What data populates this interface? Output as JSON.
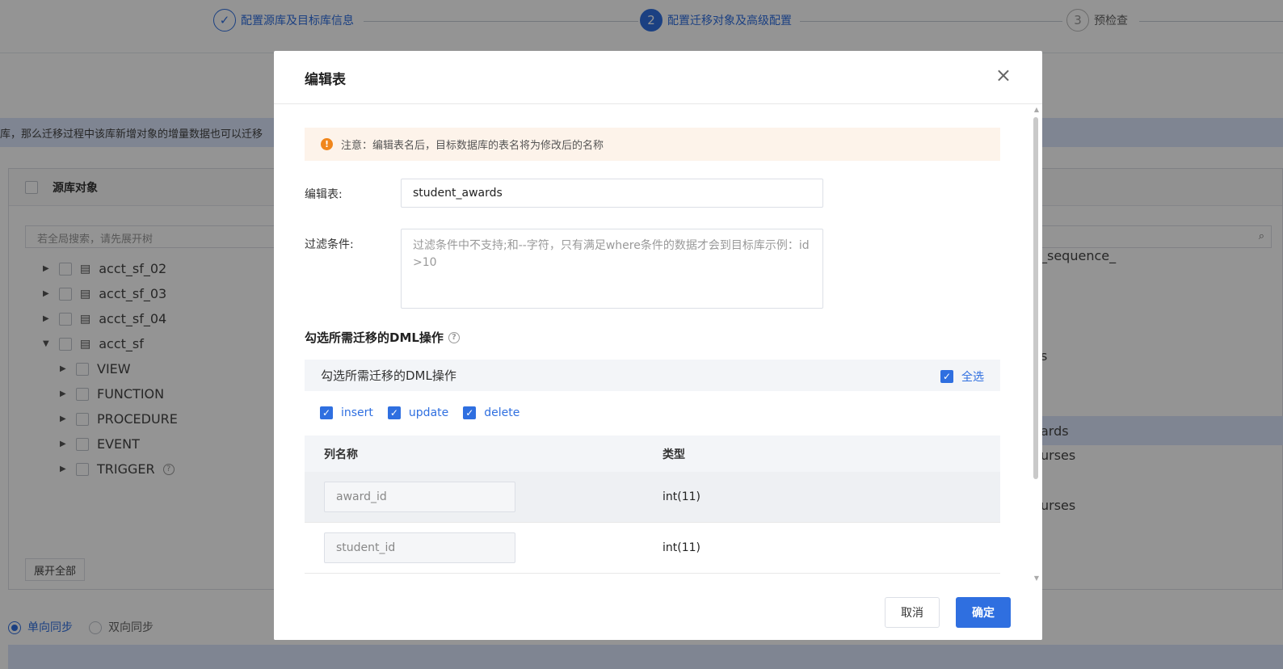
{
  "steps": [
    {
      "label": "配置源库及目标库信息",
      "number": "✓",
      "state": "done"
    },
    {
      "label": "配置迁移对象及高级配置",
      "number": "2",
      "state": "active"
    },
    {
      "label": "预检查",
      "number": "3",
      "state": "todo"
    }
  ],
  "notice_text": "库，那么迁移过程中该库新增对象的增量数据也可以迁移",
  "source_panel": {
    "header": "源库对象",
    "search_placeholder": "若全局搜索，请先展开树",
    "tree": [
      {
        "label": "acct_sf_02",
        "expanded": false
      },
      {
        "label": "acct_sf_03",
        "expanded": false
      },
      {
        "label": "acct_sf_04",
        "expanded": false
      },
      {
        "label": "acct_sf",
        "expanded": true
      },
      {
        "label": "VIEW",
        "child": true
      },
      {
        "label": "FUNCTION",
        "child": true
      },
      {
        "label": "PROCEDURE",
        "child": true
      },
      {
        "label": "EVENT",
        "child": true
      },
      {
        "label": "TRIGGER",
        "child": true
      }
    ],
    "expand_all": "展开全部"
  },
  "dest_panel_fragments": [
    "_sequence_",
    "s",
    "ards",
    "urses",
    "urses"
  ],
  "sync_options": {
    "one_way": "单向同步",
    "two_way": "双向同步"
  },
  "modal": {
    "title": "编辑表",
    "warning": "注意：编辑表名后，目标数据库的表名将为修改后的名称",
    "edit_table_label": "编辑表:",
    "edit_table_value": "student_awards",
    "filter_label": "过滤条件:",
    "filter_placeholder": "过滤条件中不支持;和--字符，只有满足where条件的数据才会到目标库示例：id >10",
    "dml_section_title": "勾选所需迁移的DML操作",
    "dml_bar_label": "勾选所需迁移的DML操作",
    "select_all": "全选",
    "ops": [
      "insert",
      "update",
      "delete"
    ],
    "columns_header": {
      "name": "列名称",
      "type": "类型"
    },
    "columns": [
      {
        "name": "award_id",
        "type": "int(11)"
      },
      {
        "name": "student_id",
        "type": "int(11)"
      }
    ],
    "cancel": "取消",
    "confirm": "确定"
  },
  "colors": {
    "accent": "#2f6fe0",
    "warning": "#f0861c",
    "warning_bg": "#fdf3ea"
  }
}
